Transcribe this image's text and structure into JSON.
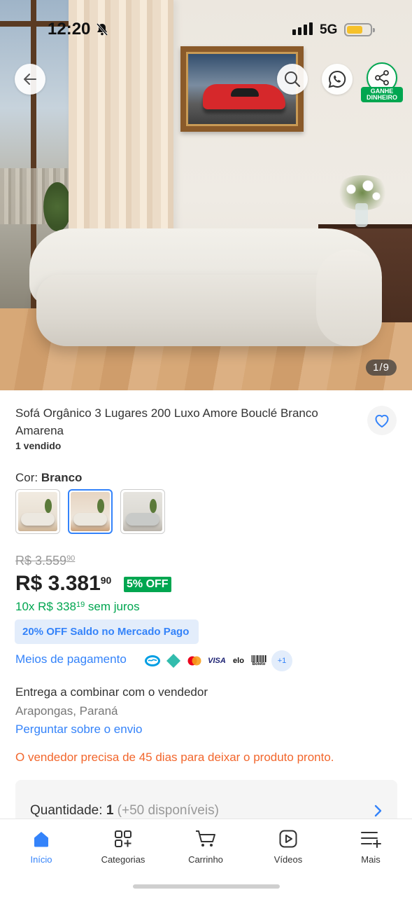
{
  "status_bar": {
    "time": "12:20",
    "network": "5G"
  },
  "hero": {
    "image_counter": "1/9"
  },
  "top_actions": {
    "share_badge": "GANHE DINHEIRO"
  },
  "product": {
    "title": "Sofá Orgânico 3 Lugares 200 Luxo Amore Bouclé Branco Amarena",
    "sold": "1 vendido",
    "color_label": "Cor: ",
    "color_value": "Branco",
    "color_options": [
      "Bege",
      "Branco",
      "Cinza"
    ],
    "selected_color_index": 1
  },
  "pricing": {
    "old_price_main": "R$ 3.559",
    "old_price_cents": "90",
    "price_main": "R$ 3.381",
    "price_cents": "90",
    "discount": "5% OFF",
    "installments_prefix": "10x R$ 338",
    "installments_cents": "19",
    "installments_suffix": " sem juros",
    "mp_badge": "20% OFF Saldo no Mercado Pago",
    "payment_link": "Meios de pagamento",
    "payment_more": "+1",
    "payment_methods": [
      "mercado-pago",
      "pix",
      "mastercard",
      "visa",
      "elo",
      "boleto"
    ],
    "payment_labels": {
      "visa": "VISA",
      "elo": "elo",
      "boleto": "Boleto"
    }
  },
  "delivery": {
    "title": "Entrega a combinar com o vendedor",
    "location": "Arapongas, Paraná",
    "ask_link": "Perguntar sobre o envio",
    "notice": "O vendedor precisa de 45 dias para deixar o produto pronto."
  },
  "quantity": {
    "label": "Quantidade:",
    "value": "1",
    "available": "(+50 disponíveis)"
  },
  "bottom_nav": {
    "items": [
      {
        "label": "Início",
        "icon": "home-icon",
        "active": true
      },
      {
        "label": "Categorias",
        "icon": "categories-icon",
        "active": false
      },
      {
        "label": "Carrinho",
        "icon": "cart-icon",
        "active": false
      },
      {
        "label": "Vídeos",
        "icon": "video-icon",
        "active": false
      },
      {
        "label": "Mais",
        "icon": "menu-plus-icon",
        "active": false
      }
    ]
  },
  "colors": {
    "accent_blue": "#3483fa",
    "success_green": "#00a650",
    "warning_orange": "#f2662c"
  }
}
